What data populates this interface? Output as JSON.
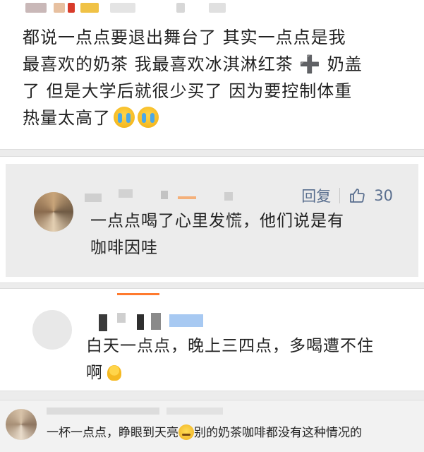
{
  "comments": [
    {
      "text": "都说一点点要退出舞台了 其实一点点是我\n最喜欢的奶茶 我最喜欢冰淇淋红茶 ➕ 奶盖\n了 但是大学后就很少买了 因为要控制体重\n热量太高了",
      "emoji_icons": [
        "crying-face-icon",
        "crying-face-icon"
      ]
    },
    {
      "reply_label": "回复",
      "like_count": "30",
      "text": "一点点喝了心里发慌，他们说是有\n咖啡因哇"
    },
    {
      "text": "白天一点点，晚上三四点，多喝遭不住\n啊",
      "emoji_icon": "sweat-face-icon"
    },
    {
      "text_before": "一杯一点点，睁眼到天亮",
      "text_after": "别的奶茶咖啡都没有这种情况的",
      "emoji_icon": "confused-face-icon"
    }
  ],
  "colors": {
    "link_blue": "#5a6f8f",
    "accent_orange": "#ff7a2e",
    "background": "#ececec"
  }
}
